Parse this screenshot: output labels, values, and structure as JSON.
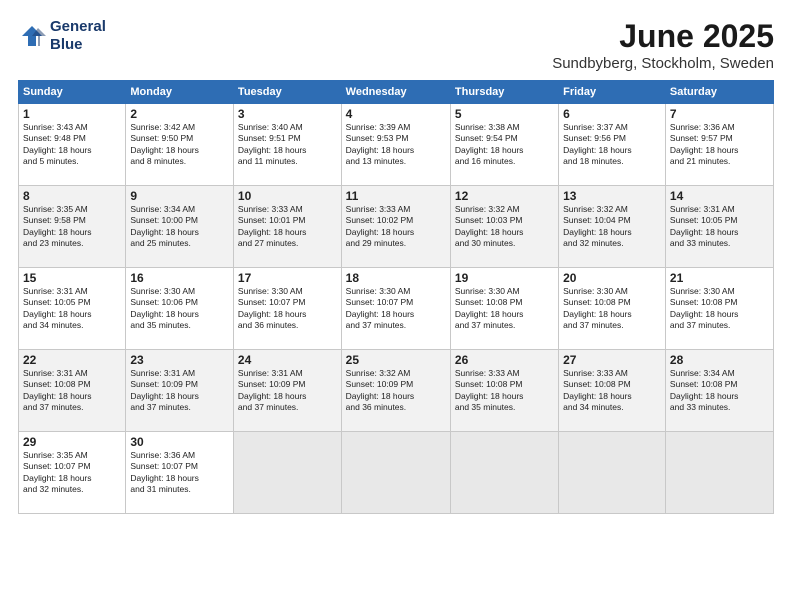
{
  "header": {
    "logo_line1": "General",
    "logo_line2": "Blue",
    "title": "June 2025",
    "location": "Sundbyberg, Stockholm, Sweden"
  },
  "days_of_week": [
    "Sunday",
    "Monday",
    "Tuesday",
    "Wednesday",
    "Thursday",
    "Friday",
    "Saturday"
  ],
  "weeks": [
    [
      {
        "day": "1",
        "info": "Sunrise: 3:43 AM\nSunset: 9:48 PM\nDaylight: 18 hours\nand 5 minutes."
      },
      {
        "day": "2",
        "info": "Sunrise: 3:42 AM\nSunset: 9:50 PM\nDaylight: 18 hours\nand 8 minutes."
      },
      {
        "day": "3",
        "info": "Sunrise: 3:40 AM\nSunset: 9:51 PM\nDaylight: 18 hours\nand 11 minutes."
      },
      {
        "day": "4",
        "info": "Sunrise: 3:39 AM\nSunset: 9:53 PM\nDaylight: 18 hours\nand 13 minutes."
      },
      {
        "day": "5",
        "info": "Sunrise: 3:38 AM\nSunset: 9:54 PM\nDaylight: 18 hours\nand 16 minutes."
      },
      {
        "day": "6",
        "info": "Sunrise: 3:37 AM\nSunset: 9:56 PM\nDaylight: 18 hours\nand 18 minutes."
      },
      {
        "day": "7",
        "info": "Sunrise: 3:36 AM\nSunset: 9:57 PM\nDaylight: 18 hours\nand 21 minutes."
      }
    ],
    [
      {
        "day": "8",
        "info": "Sunrise: 3:35 AM\nSunset: 9:58 PM\nDaylight: 18 hours\nand 23 minutes."
      },
      {
        "day": "9",
        "info": "Sunrise: 3:34 AM\nSunset: 10:00 PM\nDaylight: 18 hours\nand 25 minutes."
      },
      {
        "day": "10",
        "info": "Sunrise: 3:33 AM\nSunset: 10:01 PM\nDaylight: 18 hours\nand 27 minutes."
      },
      {
        "day": "11",
        "info": "Sunrise: 3:33 AM\nSunset: 10:02 PM\nDaylight: 18 hours\nand 29 minutes."
      },
      {
        "day": "12",
        "info": "Sunrise: 3:32 AM\nSunset: 10:03 PM\nDaylight: 18 hours\nand 30 minutes."
      },
      {
        "day": "13",
        "info": "Sunrise: 3:32 AM\nSunset: 10:04 PM\nDaylight: 18 hours\nand 32 minutes."
      },
      {
        "day": "14",
        "info": "Sunrise: 3:31 AM\nSunset: 10:05 PM\nDaylight: 18 hours\nand 33 minutes."
      }
    ],
    [
      {
        "day": "15",
        "info": "Sunrise: 3:31 AM\nSunset: 10:05 PM\nDaylight: 18 hours\nand 34 minutes."
      },
      {
        "day": "16",
        "info": "Sunrise: 3:30 AM\nSunset: 10:06 PM\nDaylight: 18 hours\nand 35 minutes."
      },
      {
        "day": "17",
        "info": "Sunrise: 3:30 AM\nSunset: 10:07 PM\nDaylight: 18 hours\nand 36 minutes."
      },
      {
        "day": "18",
        "info": "Sunrise: 3:30 AM\nSunset: 10:07 PM\nDaylight: 18 hours\nand 37 minutes."
      },
      {
        "day": "19",
        "info": "Sunrise: 3:30 AM\nSunset: 10:08 PM\nDaylight: 18 hours\nand 37 minutes."
      },
      {
        "day": "20",
        "info": "Sunrise: 3:30 AM\nSunset: 10:08 PM\nDaylight: 18 hours\nand 37 minutes."
      },
      {
        "day": "21",
        "info": "Sunrise: 3:30 AM\nSunset: 10:08 PM\nDaylight: 18 hours\nand 37 minutes."
      }
    ],
    [
      {
        "day": "22",
        "info": "Sunrise: 3:31 AM\nSunset: 10:08 PM\nDaylight: 18 hours\nand 37 minutes."
      },
      {
        "day": "23",
        "info": "Sunrise: 3:31 AM\nSunset: 10:09 PM\nDaylight: 18 hours\nand 37 minutes."
      },
      {
        "day": "24",
        "info": "Sunrise: 3:31 AM\nSunset: 10:09 PM\nDaylight: 18 hours\nand 37 minutes."
      },
      {
        "day": "25",
        "info": "Sunrise: 3:32 AM\nSunset: 10:09 PM\nDaylight: 18 hours\nand 36 minutes."
      },
      {
        "day": "26",
        "info": "Sunrise: 3:33 AM\nSunset: 10:08 PM\nDaylight: 18 hours\nand 35 minutes."
      },
      {
        "day": "27",
        "info": "Sunrise: 3:33 AM\nSunset: 10:08 PM\nDaylight: 18 hours\nand 34 minutes."
      },
      {
        "day": "28",
        "info": "Sunrise: 3:34 AM\nSunset: 10:08 PM\nDaylight: 18 hours\nand 33 minutes."
      }
    ],
    [
      {
        "day": "29",
        "info": "Sunrise: 3:35 AM\nSunset: 10:07 PM\nDaylight: 18 hours\nand 32 minutes."
      },
      {
        "day": "30",
        "info": "Sunrise: 3:36 AM\nSunset: 10:07 PM\nDaylight: 18 hours\nand 31 minutes."
      },
      {
        "day": "",
        "info": ""
      },
      {
        "day": "",
        "info": ""
      },
      {
        "day": "",
        "info": ""
      },
      {
        "day": "",
        "info": ""
      },
      {
        "day": "",
        "info": ""
      }
    ]
  ]
}
